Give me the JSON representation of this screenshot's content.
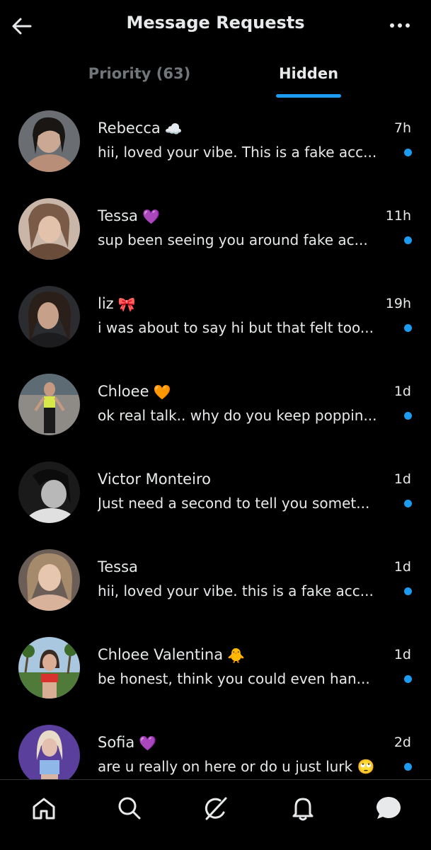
{
  "header": {
    "title": "Message Requests",
    "back_icon": "arrow-left-icon",
    "more_icon": "more-horizontal-icon"
  },
  "tabs": [
    {
      "label": "Priority (63)",
      "active": false
    },
    {
      "label": "Hidden",
      "active": true
    }
  ],
  "colors": {
    "accent": "#1d9bf0",
    "background": "#000000",
    "text": "#e7e9ea",
    "muted": "#71767b"
  },
  "messages": [
    {
      "name": "Rebecca",
      "emoji": "☁️",
      "time": "7h",
      "preview": "hii, loved your vibe. This is a fake acc...",
      "unread": true
    },
    {
      "name": "Tessa",
      "emoji": "💜",
      "time": "11h",
      "preview": "sup been seeing you around fake ac...",
      "unread": true
    },
    {
      "name": "liz",
      "emoji": "🎀",
      "time": "19h",
      "preview": "i was about to say hi but that felt too...",
      "unread": true
    },
    {
      "name": "Chloee",
      "emoji": "🧡",
      "time": "1d",
      "preview": "ok real talk.. why do you keep poppin...",
      "unread": true
    },
    {
      "name": "Victor Monteiro",
      "emoji": "",
      "time": "1d",
      "preview": "Just need a second to tell you somet...",
      "unread": true
    },
    {
      "name": "Tessa",
      "emoji": "",
      "time": "1d",
      "preview": "hii, loved your vibe. this is a fake acc...",
      "unread": true
    },
    {
      "name": "Chloee Valentina",
      "emoji": "🐥",
      "time": "1d",
      "preview": "be honest, think you could even han...",
      "unread": true
    },
    {
      "name": "Sofia",
      "emoji": "💜",
      "time": "2d",
      "preview": "are u really on here or do u just lurk 🙄",
      "unread": true
    }
  ],
  "bottom_nav": [
    {
      "icon": "home-icon"
    },
    {
      "icon": "search-icon"
    },
    {
      "icon": "grok-icon"
    },
    {
      "icon": "notifications-bell-icon"
    },
    {
      "icon": "messages-icon",
      "active": true
    }
  ]
}
